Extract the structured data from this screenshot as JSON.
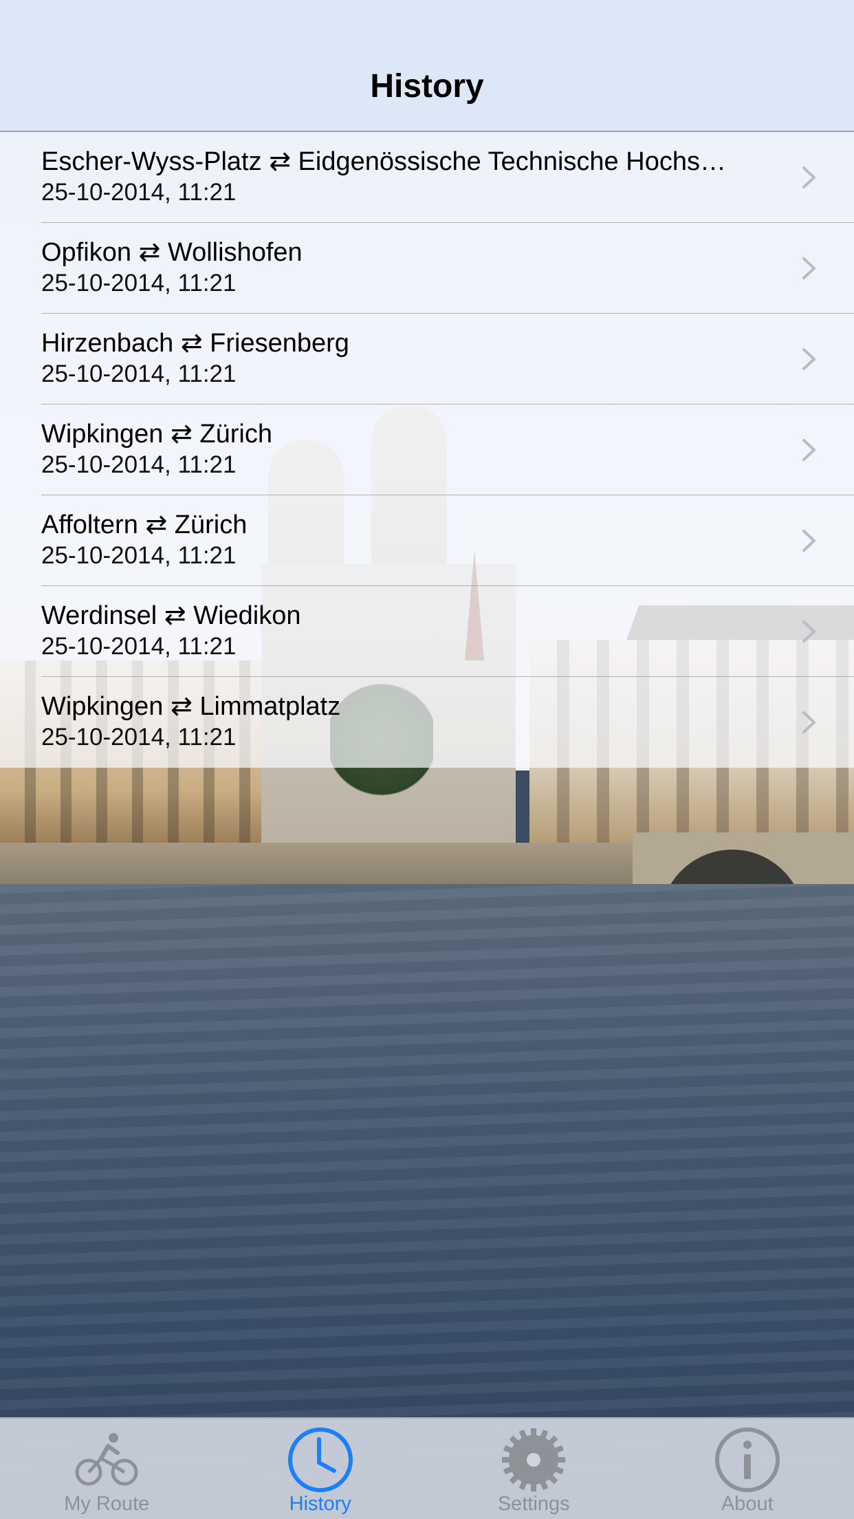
{
  "nav": {
    "title": "History"
  },
  "history": [
    {
      "route": "Escher-Wyss-Platz ⇄ Eidgenössische Technische Hochs…",
      "datetime": "25-10-2014, 11:21"
    },
    {
      "route": "Opfikon ⇄ Wollishofen",
      "datetime": "25-10-2014, 11:21"
    },
    {
      "route": "Hirzenbach ⇄ Friesenberg",
      "datetime": "25-10-2014, 11:21"
    },
    {
      "route": "Wipkingen ⇄ Zürich",
      "datetime": "25-10-2014, 11:21"
    },
    {
      "route": "Affoltern ⇄ Zürich",
      "datetime": "25-10-2014, 11:21"
    },
    {
      "route": "Werdinsel ⇄ Wiedikon",
      "datetime": "25-10-2014, 11:21"
    },
    {
      "route": "Wipkingen ⇄ Limmatplatz",
      "datetime": "25-10-2014, 11:21"
    }
  ],
  "tabs": [
    {
      "label": "My Route",
      "icon": "bicycle-icon",
      "active": false
    },
    {
      "label": "History",
      "icon": "clock-icon",
      "active": true
    },
    {
      "label": "Settings",
      "icon": "gear-icon",
      "active": false
    },
    {
      "label": "About",
      "icon": "info-icon",
      "active": false
    }
  ],
  "colors": {
    "accent": "#1b7ff5",
    "tab_inactive": "#8e9196",
    "chevron": "#b8bcc4"
  }
}
